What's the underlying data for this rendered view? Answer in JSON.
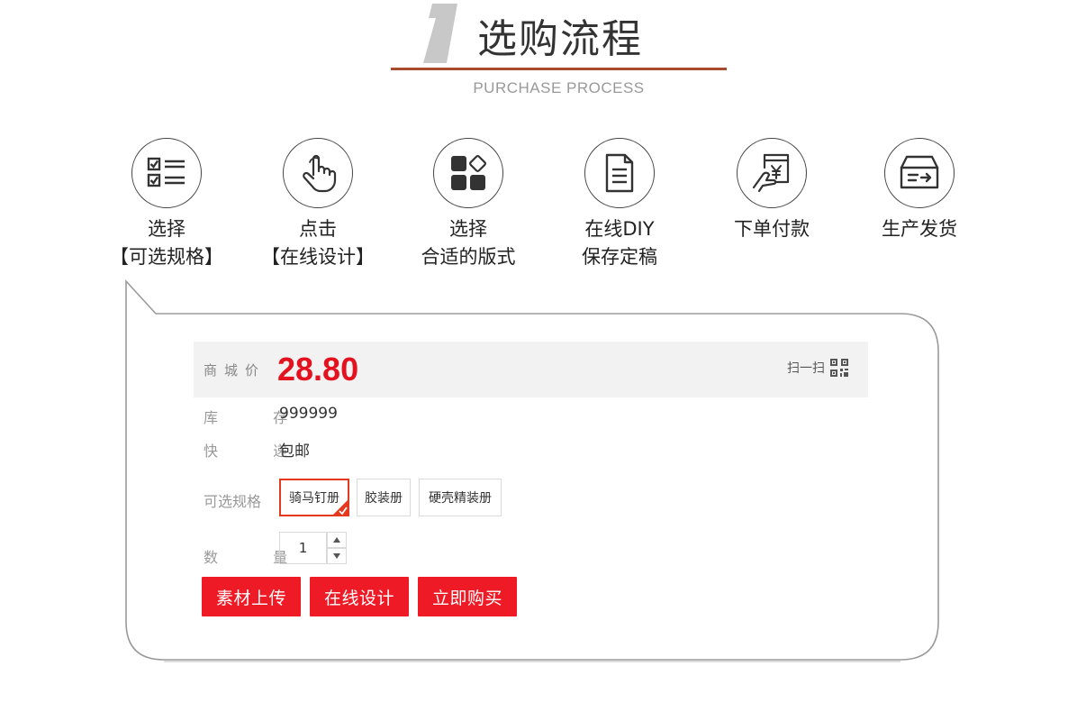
{
  "header": {
    "title": "选购流程",
    "subtitle": "PURCHASE PROCESS",
    "accent_color": "#a84a2c"
  },
  "steps": [
    {
      "icon": "checklist-icon",
      "line1": "选择",
      "line2": "【可选规格】"
    },
    {
      "icon": "hand-pointer-icon",
      "line1": "点击",
      "line2": "【在线设计】"
    },
    {
      "icon": "layout-grid-icon",
      "line1": "选择",
      "line2": "合适的版式"
    },
    {
      "icon": "document-icon",
      "line1": "在线DIY",
      "line2": "保存定稿"
    },
    {
      "icon": "payment-icon",
      "line1": "下单付款",
      "line2": ""
    },
    {
      "icon": "delivery-box-icon",
      "line1": "生产发货",
      "line2": ""
    }
  ],
  "product": {
    "price_label": "商城价",
    "price": "28.80",
    "scan_label": "扫一扫",
    "stock_label": "库 存",
    "stock_value": "999999",
    "shipping_label": "快 递",
    "shipping_value": "包邮",
    "spec_label": "可选规格",
    "specs": [
      {
        "label": "骑马钉册",
        "selected": true
      },
      {
        "label": "胶装册",
        "selected": false
      },
      {
        "label": "硬壳精装册",
        "selected": false
      }
    ],
    "qty_label": "数 量",
    "qty_value": "1",
    "price_color": "#e4121e"
  },
  "actions": {
    "upload_label": "素材上传",
    "design_label": "在线设计",
    "buy_label": "立即购买",
    "button_color": "#ee1a25"
  }
}
